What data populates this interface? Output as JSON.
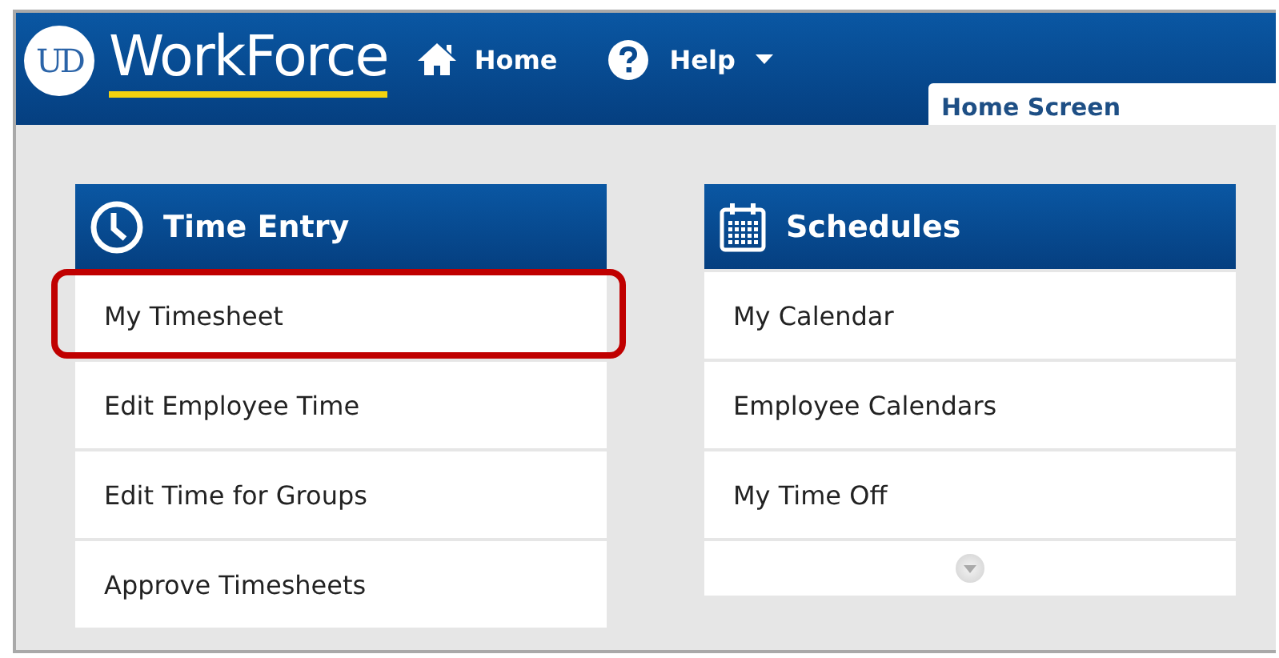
{
  "header": {
    "logo_monogram": "UD",
    "logo_text": "WorkForce",
    "nav": [
      {
        "kind": "home",
        "label": "Home"
      },
      {
        "kind": "help",
        "label": "Help",
        "dropdown": true
      }
    ],
    "tab": {
      "label": "Home Screen",
      "selected": true
    }
  },
  "cards": [
    {
      "kind": "clock",
      "title": "Time Entry",
      "items": [
        {
          "label": "My Timesheet",
          "highlighted": true
        },
        {
          "label": "Edit Employee Time",
          "highlighted": false
        },
        {
          "label": "Edit Time for Groups",
          "highlighted": false
        },
        {
          "label": "Approve Timesheets",
          "highlighted": false
        }
      ],
      "more": false
    },
    {
      "kind": "calendar",
      "title": "Schedules",
      "items": [
        {
          "label": "My Calendar",
          "highlighted": false
        },
        {
          "label": "Employee Calendars",
          "highlighted": false
        },
        {
          "label": "My Time Off",
          "highlighted": false
        }
      ],
      "more": true
    }
  ]
}
